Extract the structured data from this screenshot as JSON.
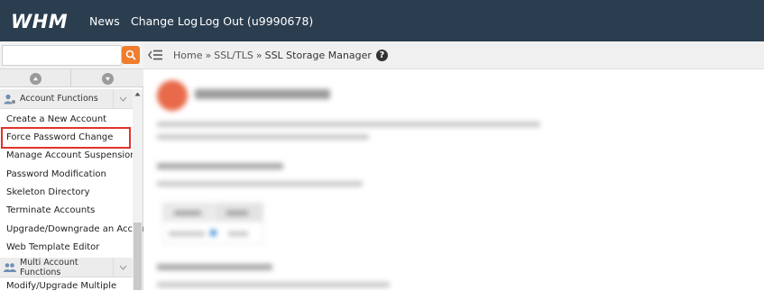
{
  "header": {
    "logo": "WHM",
    "nav": {
      "news": "News",
      "change_log": "Change Log",
      "logout": "Log Out (u9990678)"
    }
  },
  "sidebar": {
    "search": {
      "value": "",
      "placeholder": ""
    },
    "groups": [
      {
        "label": "Account Functions",
        "items": [
          "Create a New Account",
          "Force Password Change",
          "Manage Account Suspension",
          "Password Modification",
          "Skeleton Directory",
          "Terminate Accounts",
          "Upgrade/Downgrade an Account",
          "Web Template Editor"
        ]
      },
      {
        "label": "Multi Account Functions",
        "items": [
          "Modify/Upgrade Multiple"
        ]
      }
    ],
    "highlighted_item": "Force Password Change"
  },
  "breadcrumb": {
    "home": "Home",
    "section": "SSL/TLS",
    "current": "SSL Storage Manager",
    "separator": "»",
    "help": "?"
  },
  "colors": {
    "header_bg": "#2b3e50",
    "search_button": "#ef7d2d",
    "highlight_border": "#e0332a"
  }
}
